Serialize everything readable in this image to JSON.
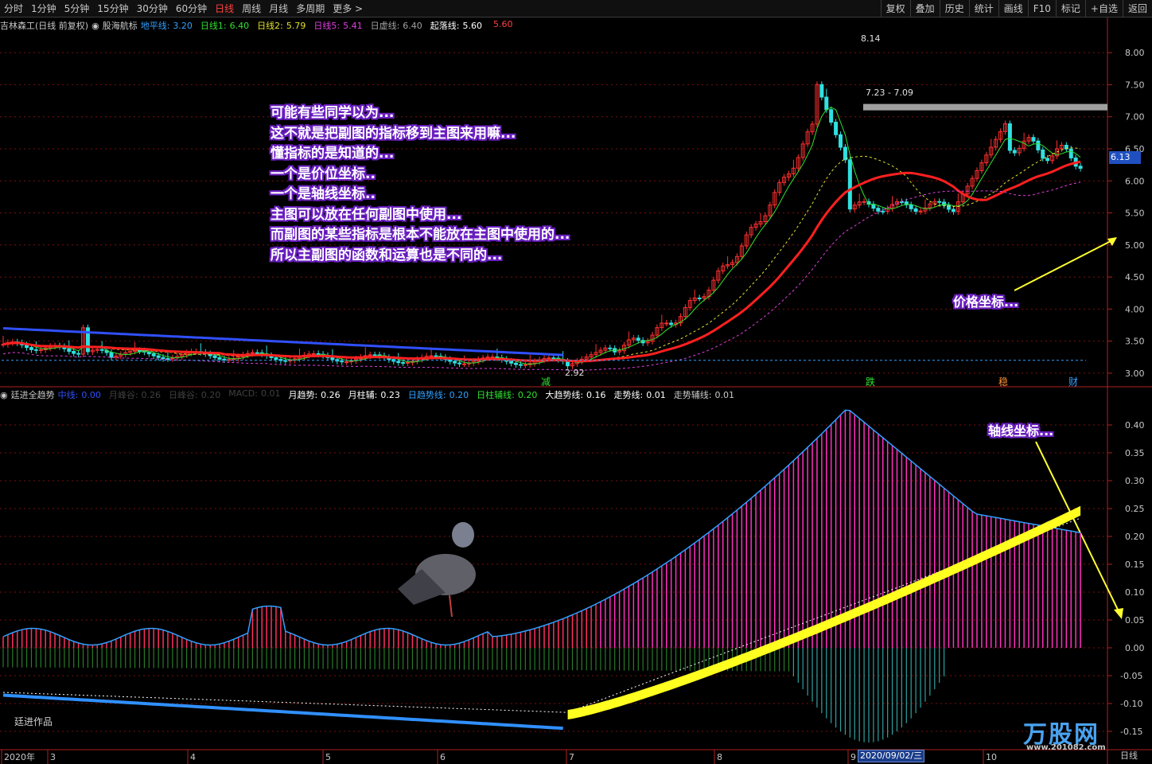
{
  "toolbar": {
    "periods": [
      "分时",
      "1分钟",
      "5分钟",
      "15分钟",
      "30分钟",
      "60分钟",
      "日线",
      "周线",
      "月线",
      "多周期",
      "更多 >"
    ],
    "active_period": "日线",
    "buttons": [
      "复权",
      "叠加",
      "历史",
      "统计",
      "画线",
      "F10",
      "标记",
      "+自选",
      "返回"
    ]
  },
  "main_header": {
    "stock": "吉林森工(日线 前复权)",
    "indicator": "股海航标",
    "items": [
      {
        "label": "地平线:",
        "value": "3.20",
        "color": "#30a0ff"
      },
      {
        "label": "日线1:",
        "value": "6.40",
        "color": "#30e030"
      },
      {
        "label": "日线2:",
        "value": "5.79",
        "color": "#e0e030"
      },
      {
        "label": "日线5:",
        "value": "5.41",
        "color": "#e040e0"
      },
      {
        "label": "日虚线:",
        "value": "6.40",
        "color": "#a0a0a0"
      },
      {
        "label": "起落线:",
        "value": "5.60",
        "color": "#ffffff"
      },
      {
        "label": "",
        "value": "5.60",
        "color": "#ff4040"
      }
    ]
  },
  "sub_header": {
    "indicator": "廷进全趋势",
    "items": [
      {
        "label": "中线:",
        "value": "0.00",
        "color": "#3050ff"
      },
      {
        "label": "月峰谷:",
        "value": "0.26",
        "color": "#404040"
      },
      {
        "label": "日峰谷:",
        "value": "0.20",
        "color": "#404040"
      },
      {
        "label": "MACD:",
        "value": "0.01",
        "color": "#404040"
      },
      {
        "label": "月趋势:",
        "value": "0.26",
        "color": "#ffffff"
      },
      {
        "label": "月柱辅:",
        "value": "0.23",
        "color": "#ffffff"
      },
      {
        "label": "日趋势线:",
        "value": "0.20",
        "color": "#30a0ff"
      },
      {
        "label": "日柱辅线:",
        "value": "0.20",
        "color": "#30e030"
      },
      {
        "label": "大趋势线:",
        "value": "0.16",
        "color": "#ffffff"
      },
      {
        "label": "走势线:",
        "value": "0.01",
        "color": "#ffffff"
      },
      {
        "label": "走势辅线:",
        "value": "0.01",
        "color": "#c8c8c8"
      }
    ]
  },
  "annotations": {
    "main_note": [
      "可能有些同学以为...",
      "这不就是把副图的指标移到主图来用嘛...",
      "懂指标的是知道的...",
      "一个是价位坐标..",
      "一个是轴线坐标..",
      "主图可以放在任何副图中使用...",
      "而副图的某些指标是根本不能放在主图中使用的...",
      "所以主副图的函数和运算也是不同的..."
    ],
    "price_callout": "价格坐标...",
    "axis_callout": "轴线坐标...",
    "author": "廷进作品",
    "watermark": "万股网",
    "watermark_url": "www.201082.com"
  },
  "chart_data": [
    {
      "type": "candlestick",
      "name": "main",
      "ylim": [
        2.8,
        8.3
      ],
      "y_ticks": [
        "8.00",
        "7.50",
        "7.00",
        "6.50",
        "6.00",
        "5.50",
        "5.00",
        "4.50",
        "4.00",
        "3.50",
        "3.00"
      ],
      "last_price": "6.13",
      "high_label": "8.14",
      "low_label": "2.92",
      "range_label": "7.23 - 7.09",
      "markers": [
        "减",
        "跌",
        "稳",
        "财"
      ],
      "x_labels": [
        "2020年",
        "3",
        "4",
        "5",
        "6",
        "7",
        "8",
        "9",
        "10"
      ]
    },
    {
      "type": "bar",
      "name": "sub",
      "ylim": [
        -0.18,
        0.44
      ],
      "y_ticks": [
        "0.40",
        "0.35",
        "0.30",
        "0.25",
        "0.20",
        "0.15",
        "0.10",
        "0.05",
        "0.00",
        "-0.05",
        "-0.10",
        "-0.15"
      ],
      "cursor_date": "2020/09/02/三",
      "right_label": "日线"
    }
  ]
}
